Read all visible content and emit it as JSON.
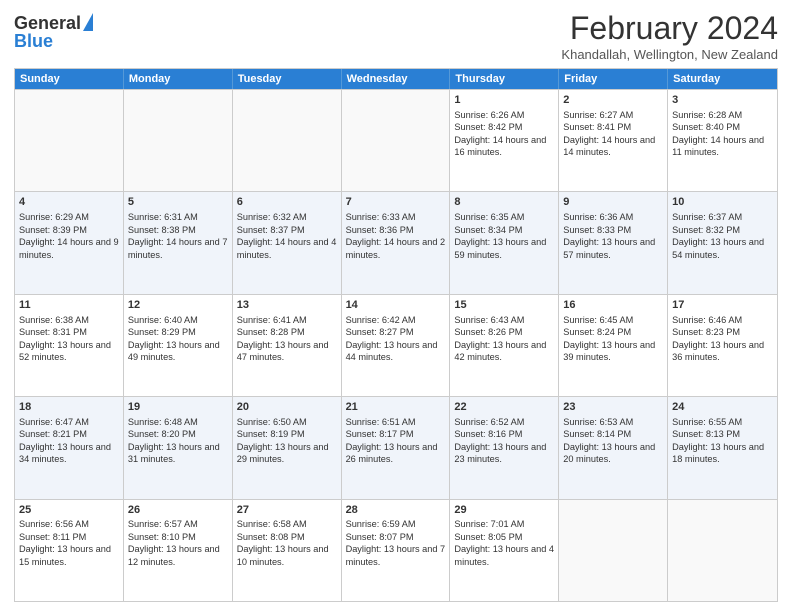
{
  "header": {
    "logo_line1": "General",
    "logo_line2": "Blue",
    "month_title": "February 2024",
    "location": "Khandallah, Wellington, New Zealand"
  },
  "weekdays": [
    "Sunday",
    "Monday",
    "Tuesday",
    "Wednesday",
    "Thursday",
    "Friday",
    "Saturday"
  ],
  "rows": [
    [
      {
        "day": "",
        "info": ""
      },
      {
        "day": "",
        "info": ""
      },
      {
        "day": "",
        "info": ""
      },
      {
        "day": "",
        "info": ""
      },
      {
        "day": "1",
        "info": "Sunrise: 6:26 AM\nSunset: 8:42 PM\nDaylight: 14 hours and 16 minutes."
      },
      {
        "day": "2",
        "info": "Sunrise: 6:27 AM\nSunset: 8:41 PM\nDaylight: 14 hours and 14 minutes."
      },
      {
        "day": "3",
        "info": "Sunrise: 6:28 AM\nSunset: 8:40 PM\nDaylight: 14 hours and 11 minutes."
      }
    ],
    [
      {
        "day": "4",
        "info": "Sunrise: 6:29 AM\nSunset: 8:39 PM\nDaylight: 14 hours and 9 minutes."
      },
      {
        "day": "5",
        "info": "Sunrise: 6:31 AM\nSunset: 8:38 PM\nDaylight: 14 hours and 7 minutes."
      },
      {
        "day": "6",
        "info": "Sunrise: 6:32 AM\nSunset: 8:37 PM\nDaylight: 14 hours and 4 minutes."
      },
      {
        "day": "7",
        "info": "Sunrise: 6:33 AM\nSunset: 8:36 PM\nDaylight: 14 hours and 2 minutes."
      },
      {
        "day": "8",
        "info": "Sunrise: 6:35 AM\nSunset: 8:34 PM\nDaylight: 13 hours and 59 minutes."
      },
      {
        "day": "9",
        "info": "Sunrise: 6:36 AM\nSunset: 8:33 PM\nDaylight: 13 hours and 57 minutes."
      },
      {
        "day": "10",
        "info": "Sunrise: 6:37 AM\nSunset: 8:32 PM\nDaylight: 13 hours and 54 minutes."
      }
    ],
    [
      {
        "day": "11",
        "info": "Sunrise: 6:38 AM\nSunset: 8:31 PM\nDaylight: 13 hours and 52 minutes."
      },
      {
        "day": "12",
        "info": "Sunrise: 6:40 AM\nSunset: 8:29 PM\nDaylight: 13 hours and 49 minutes."
      },
      {
        "day": "13",
        "info": "Sunrise: 6:41 AM\nSunset: 8:28 PM\nDaylight: 13 hours and 47 minutes."
      },
      {
        "day": "14",
        "info": "Sunrise: 6:42 AM\nSunset: 8:27 PM\nDaylight: 13 hours and 44 minutes."
      },
      {
        "day": "15",
        "info": "Sunrise: 6:43 AM\nSunset: 8:26 PM\nDaylight: 13 hours and 42 minutes."
      },
      {
        "day": "16",
        "info": "Sunrise: 6:45 AM\nSunset: 8:24 PM\nDaylight: 13 hours and 39 minutes."
      },
      {
        "day": "17",
        "info": "Sunrise: 6:46 AM\nSunset: 8:23 PM\nDaylight: 13 hours and 36 minutes."
      }
    ],
    [
      {
        "day": "18",
        "info": "Sunrise: 6:47 AM\nSunset: 8:21 PM\nDaylight: 13 hours and 34 minutes."
      },
      {
        "day": "19",
        "info": "Sunrise: 6:48 AM\nSunset: 8:20 PM\nDaylight: 13 hours and 31 minutes."
      },
      {
        "day": "20",
        "info": "Sunrise: 6:50 AM\nSunset: 8:19 PM\nDaylight: 13 hours and 29 minutes."
      },
      {
        "day": "21",
        "info": "Sunrise: 6:51 AM\nSunset: 8:17 PM\nDaylight: 13 hours and 26 minutes."
      },
      {
        "day": "22",
        "info": "Sunrise: 6:52 AM\nSunset: 8:16 PM\nDaylight: 13 hours and 23 minutes."
      },
      {
        "day": "23",
        "info": "Sunrise: 6:53 AM\nSunset: 8:14 PM\nDaylight: 13 hours and 20 minutes."
      },
      {
        "day": "24",
        "info": "Sunrise: 6:55 AM\nSunset: 8:13 PM\nDaylight: 13 hours and 18 minutes."
      }
    ],
    [
      {
        "day": "25",
        "info": "Sunrise: 6:56 AM\nSunset: 8:11 PM\nDaylight: 13 hours and 15 minutes."
      },
      {
        "day": "26",
        "info": "Sunrise: 6:57 AM\nSunset: 8:10 PM\nDaylight: 13 hours and 12 minutes."
      },
      {
        "day": "27",
        "info": "Sunrise: 6:58 AM\nSunset: 8:08 PM\nDaylight: 13 hours and 10 minutes."
      },
      {
        "day": "28",
        "info": "Sunrise: 6:59 AM\nSunset: 8:07 PM\nDaylight: 13 hours and 7 minutes."
      },
      {
        "day": "29",
        "info": "Sunrise: 7:01 AM\nSunset: 8:05 PM\nDaylight: 13 hours and 4 minutes."
      },
      {
        "day": "",
        "info": ""
      },
      {
        "day": "",
        "info": ""
      }
    ]
  ]
}
